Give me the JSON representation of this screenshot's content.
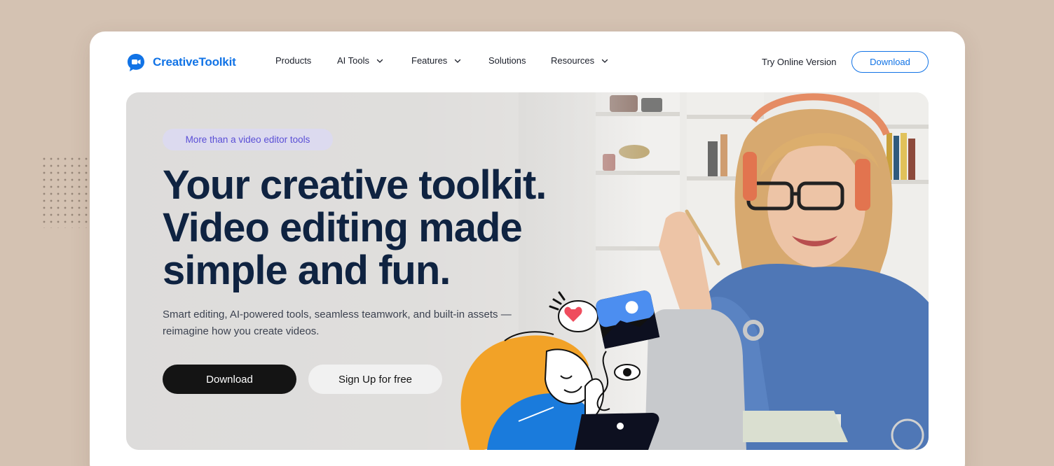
{
  "brand": {
    "name": "CreativeToolkit",
    "color": "#1173e6"
  },
  "nav": {
    "items": [
      {
        "label": "Products",
        "has_dropdown": false
      },
      {
        "label": "AI Tools",
        "has_dropdown": true
      },
      {
        "label": "Features",
        "has_dropdown": true
      },
      {
        "label": "Solutions",
        "has_dropdown": false
      },
      {
        "label": "Resources",
        "has_dropdown": true
      }
    ],
    "try_online": "Try Online Version",
    "download": "Download"
  },
  "hero": {
    "badge": "More than a video editor tools",
    "headline_lines": [
      "Your creative toolkit.",
      "Video editing made",
      "simple and fun."
    ],
    "subtext": "Smart editing, AI-powered tools, seamless teamwork, and built-in assets — reimagine how you create videos.",
    "primary_button": "Download",
    "secondary_button": "Sign Up for free"
  },
  "icons": {
    "logo": "chat-video-logo-icon",
    "dropdown": "chevron-down-icon"
  },
  "colors": {
    "background": "#d4c2b2",
    "headline": "#0f2341",
    "badge_bg": "#dcdaef",
    "badge_text": "#5a4fd6",
    "primary_button": "#141414"
  }
}
